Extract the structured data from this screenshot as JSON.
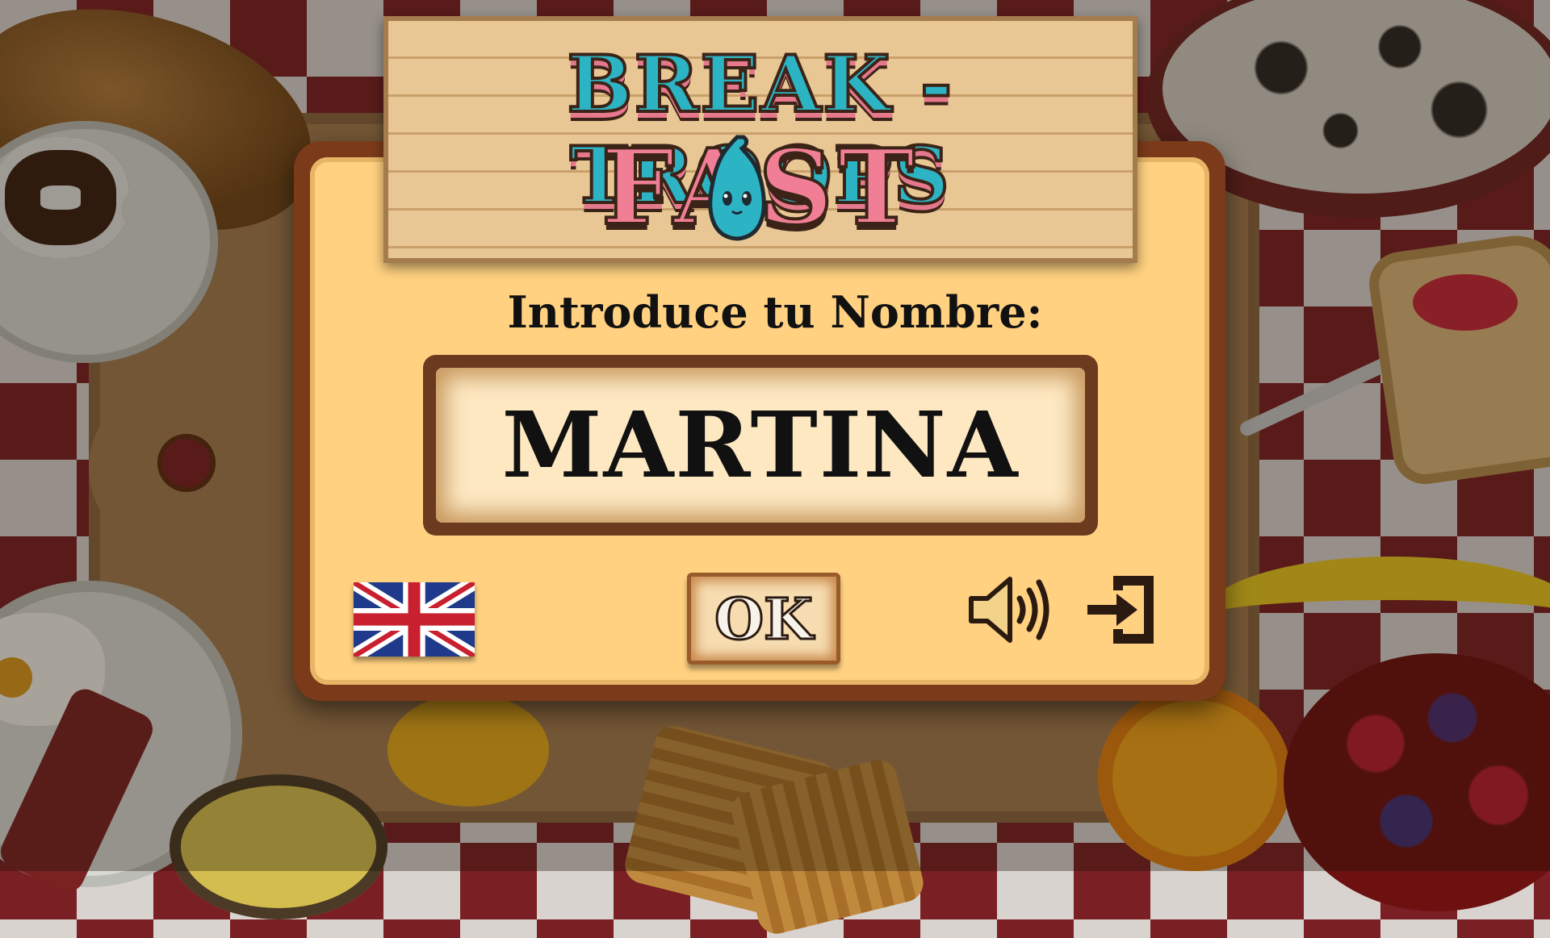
{
  "game": {
    "title_line1": "BREAK - TROOPS",
    "title_line2": "FAST"
  },
  "name_entry": {
    "prompt": "Introduce tu Nombre:",
    "value": "MARTINA"
  },
  "controls": {
    "language_icon": "uk-flag-icon",
    "ok_label": "OK",
    "sound_icon": "speaker-icon",
    "exit_icon": "exit-icon"
  },
  "colors": {
    "panel_border": "#7b3a1a",
    "panel_fill": "#ffd181",
    "logo_blue": "#2db4c4",
    "logo_pink": "#f07f96",
    "tablecloth_red": "#7a1f24"
  }
}
